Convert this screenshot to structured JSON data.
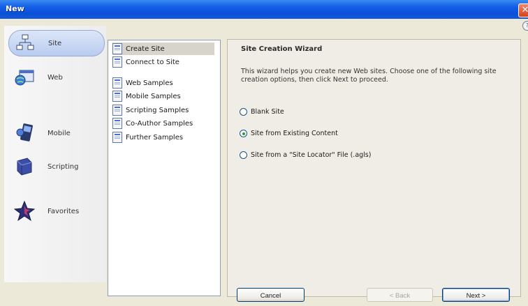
{
  "window": {
    "title": "New",
    "close_symbol": "✕",
    "help_symbol": "?"
  },
  "rail": {
    "items": [
      {
        "label": "Site",
        "icon": "site-icon",
        "active": true
      },
      {
        "label": "Web",
        "icon": "web-icon",
        "active": false
      },
      {
        "label": "Mobile",
        "icon": "mobile-icon",
        "active": false
      },
      {
        "label": "Scripting",
        "icon": "scripting-icon",
        "active": false
      },
      {
        "label": "Favorites",
        "icon": "favorites-star-icon",
        "active": false
      }
    ]
  },
  "list": {
    "items": [
      {
        "label": "Create Site",
        "selected": true
      },
      {
        "label": "Connect to Site",
        "selected": false
      },
      {
        "label": "Web Samples",
        "selected": false
      },
      {
        "label": "Mobile Samples",
        "selected": false
      },
      {
        "label": "Scripting Samples",
        "selected": false
      },
      {
        "label": "Co-Author Samples",
        "selected": false
      },
      {
        "label": "Further Samples",
        "selected": false
      }
    ]
  },
  "wizard": {
    "title": "Site Creation Wizard",
    "description": "This wizard helps you create new Web sites. Choose one of the following site creation options, then click Next to proceed.",
    "options": [
      {
        "label": "Blank Site",
        "checked": false
      },
      {
        "label": "Site from Existing Content",
        "checked": true
      },
      {
        "label": "Site from a \"Site Locator\" File (.agls)",
        "checked": false
      }
    ]
  },
  "buttons": {
    "cancel": "Cancel",
    "back": "< Back",
    "next": "Next >"
  },
  "colors": {
    "titlebar": "#0A4FD8",
    "accent": "#95A9D8",
    "radio_checked": "#2a9a3a"
  }
}
